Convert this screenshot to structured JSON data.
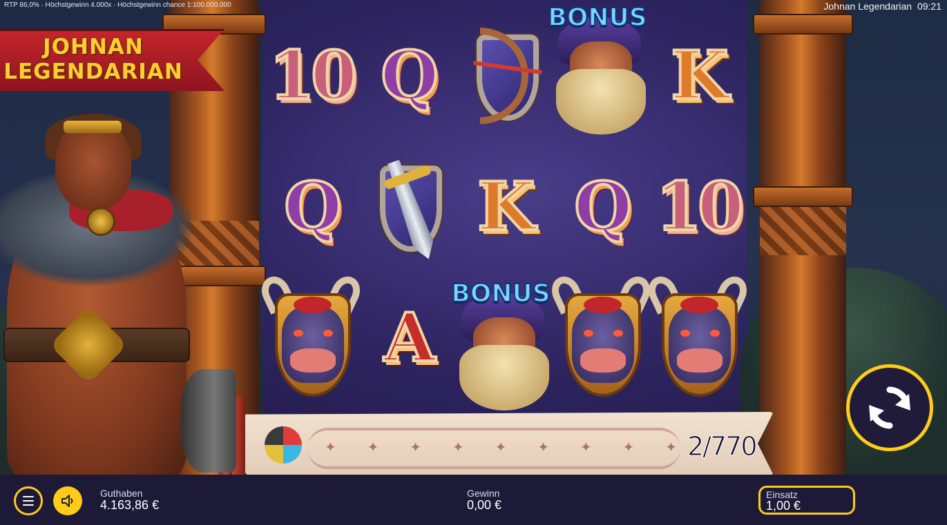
{
  "top_bar": {
    "info": "RTP 86,0% · Höchstgewinn 4.000x · Höchstgewinn chance 1:100.000.000",
    "game_title": "Johnan Legendarian",
    "time": "09:21"
  },
  "logo": {
    "line1": "JOHNAN",
    "line2": "LEGENDARIAN",
    "color": "#ffcc33",
    "banner_color": "#c4252b"
  },
  "reels": {
    "rows": [
      [
        "10",
        "Q",
        "bow-shield",
        "wizard-bonus",
        "K"
      ],
      [
        "Q",
        "sword-shield",
        "K",
        "Q",
        "10"
      ],
      [
        "bull",
        "A",
        "wizard-bonus",
        "bull",
        "bull"
      ]
    ],
    "bonus_label": "BONUS"
  },
  "progress": {
    "text": "2/770"
  },
  "hud": {
    "balance_label": "Guthaben",
    "balance_value": "4.163,86 €",
    "win_label": "Gewinn",
    "win_value": "0,00 €",
    "bet_label": "Einsatz",
    "bet_value": "1,00 €"
  },
  "colors": {
    "accent": "#ffcc1a",
    "hud_bg": "#1d1a38"
  }
}
